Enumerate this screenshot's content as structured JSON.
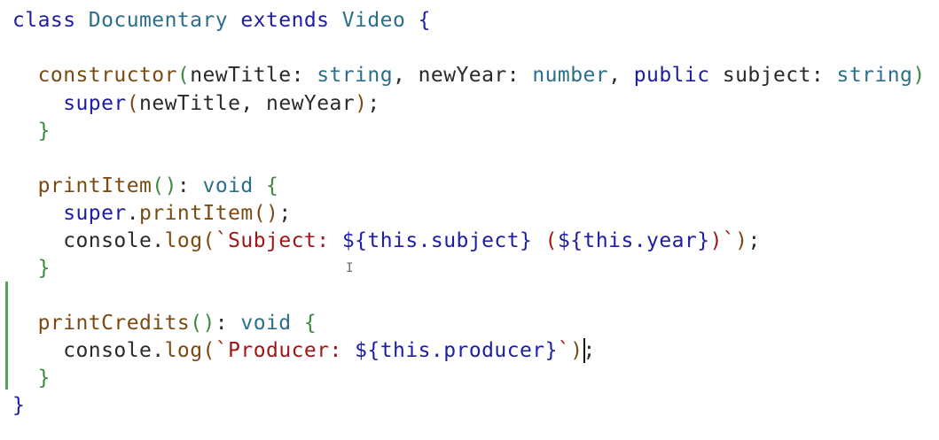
{
  "editor": {
    "lines": [
      {
        "tokens": [
          {
            "t": "class ",
            "c": "kw"
          },
          {
            "t": "Documentary ",
            "c": "type"
          },
          {
            "t": "extends ",
            "c": "kw"
          },
          {
            "t": "Video ",
            "c": "type"
          },
          {
            "t": "{",
            "c": "kw"
          }
        ]
      },
      {
        "tokens": []
      },
      {
        "tokens": [
          {
            "t": "  ",
            "c": "plain"
          },
          {
            "t": "constructor",
            "c": "fn"
          },
          {
            "t": "(",
            "c": "br"
          },
          {
            "t": "newTitle",
            "c": "plain"
          },
          {
            "t": ": ",
            "c": "plain"
          },
          {
            "t": "string",
            "c": "type"
          },
          {
            "t": ", ",
            "c": "plain"
          },
          {
            "t": "newYear",
            "c": "plain"
          },
          {
            "t": ": ",
            "c": "plain"
          },
          {
            "t": "number",
            "c": "type"
          },
          {
            "t": ", ",
            "c": "plain"
          },
          {
            "t": "public ",
            "c": "kw"
          },
          {
            "t": "subject",
            "c": "plain"
          },
          {
            "t": ": ",
            "c": "plain"
          },
          {
            "t": "string",
            "c": "type"
          },
          {
            "t": ") ",
            "c": "br"
          },
          {
            "t": "{",
            "c": "br"
          }
        ]
      },
      {
        "tokens": [
          {
            "t": "    ",
            "c": "plain"
          },
          {
            "t": "super",
            "c": "kw"
          },
          {
            "t": "(",
            "c": "fn"
          },
          {
            "t": "newTitle",
            "c": "plain"
          },
          {
            "t": ", ",
            "c": "plain"
          },
          {
            "t": "newYear",
            "c": "plain"
          },
          {
            "t": ")",
            "c": "fn"
          },
          {
            "t": ";",
            "c": "plain"
          }
        ]
      },
      {
        "tokens": [
          {
            "t": "  ",
            "c": "plain"
          },
          {
            "t": "}",
            "c": "br"
          }
        ]
      },
      {
        "tokens": []
      },
      {
        "tokens": [
          {
            "t": "  ",
            "c": "plain"
          },
          {
            "t": "printItem",
            "c": "fn"
          },
          {
            "t": "()",
            "c": "br"
          },
          {
            "t": ": ",
            "c": "plain"
          },
          {
            "t": "void ",
            "c": "type"
          },
          {
            "t": "{",
            "c": "br"
          }
        ]
      },
      {
        "tokens": [
          {
            "t": "    ",
            "c": "plain"
          },
          {
            "t": "super",
            "c": "kw"
          },
          {
            "t": ".",
            "c": "plain"
          },
          {
            "t": "printItem",
            "c": "fn"
          },
          {
            "t": "()",
            "c": "fn"
          },
          {
            "t": ";",
            "c": "plain"
          }
        ]
      },
      {
        "tokens": [
          {
            "t": "    ",
            "c": "plain"
          },
          {
            "t": "console",
            "c": "plain"
          },
          {
            "t": ".",
            "c": "plain"
          },
          {
            "t": "log",
            "c": "fn"
          },
          {
            "t": "(",
            "c": "fn"
          },
          {
            "t": "`Subject: ",
            "c": "str"
          },
          {
            "t": "${",
            "c": "interp"
          },
          {
            "t": "this",
            "c": "interp"
          },
          {
            "t": ".subject",
            "c": "interp"
          },
          {
            "t": "}",
            "c": "interp"
          },
          {
            "t": " (",
            "c": "str"
          },
          {
            "t": "${",
            "c": "interp"
          },
          {
            "t": "this",
            "c": "interp"
          },
          {
            "t": ".year",
            "c": "interp"
          },
          {
            "t": "}",
            "c": "interp"
          },
          {
            "t": ")`",
            "c": "str"
          },
          {
            "t": ")",
            "c": "fn"
          },
          {
            "t": ";",
            "c": "plain"
          }
        ]
      },
      {
        "tokens": [
          {
            "t": "  ",
            "c": "plain"
          },
          {
            "t": "}",
            "c": "br"
          }
        ]
      },
      {
        "tokens": []
      },
      {
        "tokens": [
          {
            "t": "  ",
            "c": "plain"
          },
          {
            "t": "printCredits",
            "c": "fn"
          },
          {
            "t": "()",
            "c": "br"
          },
          {
            "t": ": ",
            "c": "plain"
          },
          {
            "t": "void ",
            "c": "type"
          },
          {
            "t": "{",
            "c": "br"
          }
        ]
      },
      {
        "tokens": [
          {
            "t": "    ",
            "c": "plain"
          },
          {
            "t": "console",
            "c": "plain"
          },
          {
            "t": ".",
            "c": "plain"
          },
          {
            "t": "log",
            "c": "fn"
          },
          {
            "t": "(",
            "c": "fn"
          },
          {
            "t": "`Producer: ",
            "c": "str"
          },
          {
            "t": "${",
            "c": "interp"
          },
          {
            "t": "this",
            "c": "interp"
          },
          {
            "t": ".producer",
            "c": "interp"
          },
          {
            "t": "}",
            "c": "interp"
          },
          {
            "t": "`",
            "c": "str"
          },
          {
            "t": ")",
            "c": "fn"
          },
          {
            "t": ";",
            "c": "plain"
          }
        ]
      },
      {
        "tokens": [
          {
            "t": "  ",
            "c": "plain"
          },
          {
            "t": "}",
            "c": "br"
          }
        ]
      },
      {
        "tokens": [
          {
            "t": "}",
            "c": "kw"
          }
        ]
      }
    ],
    "colors": {
      "keyword": "#1d1da6",
      "type": "#2c6f8c",
      "function": "#7a4a12",
      "brace": "#3e8a3e",
      "string": "#a31515",
      "modified_gutter": "#5aa05a"
    },
    "icons": {
      "mouse_cursor": "i-beam-icon"
    }
  }
}
